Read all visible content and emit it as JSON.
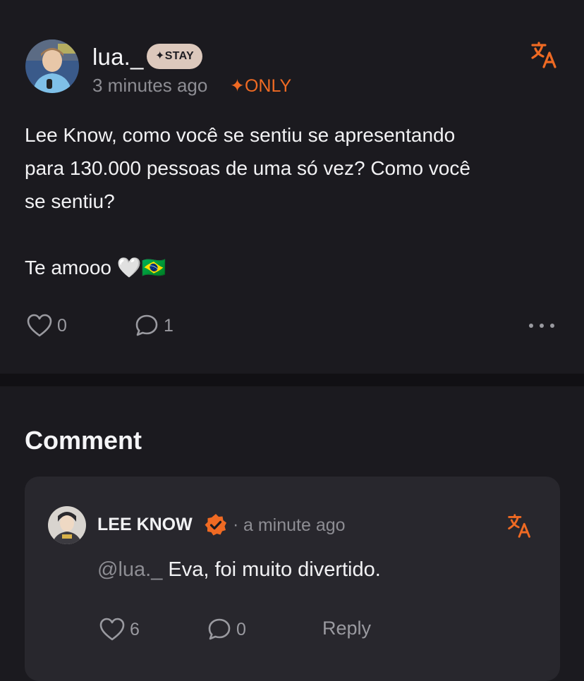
{
  "post": {
    "author": {
      "username": "lua._",
      "badge": "✦STAY",
      "avatar_icon": "user-avatar"
    },
    "timestamp": "3 minutes ago",
    "visibility_tag": "✦ONLY",
    "body": "Lee Know, como você se sentiu se apresentando\npara 130.000 pessoas de uma só vez? Como você\nse sentiu?\n\nTe amooo 🤍🇧🇷",
    "likes": "0",
    "comments": "1",
    "icons": {
      "translate": "translate-icon",
      "like": "heart-icon",
      "comment": "comment-bubble-icon",
      "more": "more-dots-icon"
    }
  },
  "comments_section": {
    "title": "Comment",
    "items": [
      {
        "author": "LEE KNOW",
        "verified_icon": "verified-badge-icon",
        "separator": "·",
        "timestamp": "a minute ago",
        "mention": "@lua._",
        "text": " Eva, foi muito divertido.",
        "likes": "6",
        "replies": "0",
        "reply_label": "Reply"
      }
    ]
  },
  "colors": {
    "background": "#1b1a1f",
    "divider": "#111014",
    "card": "#28272d",
    "accent": "#ef6a23",
    "badge_bg": "#dcc8bc",
    "muted_text": "#8d8d93",
    "primary_text": "#f2f2f4"
  }
}
